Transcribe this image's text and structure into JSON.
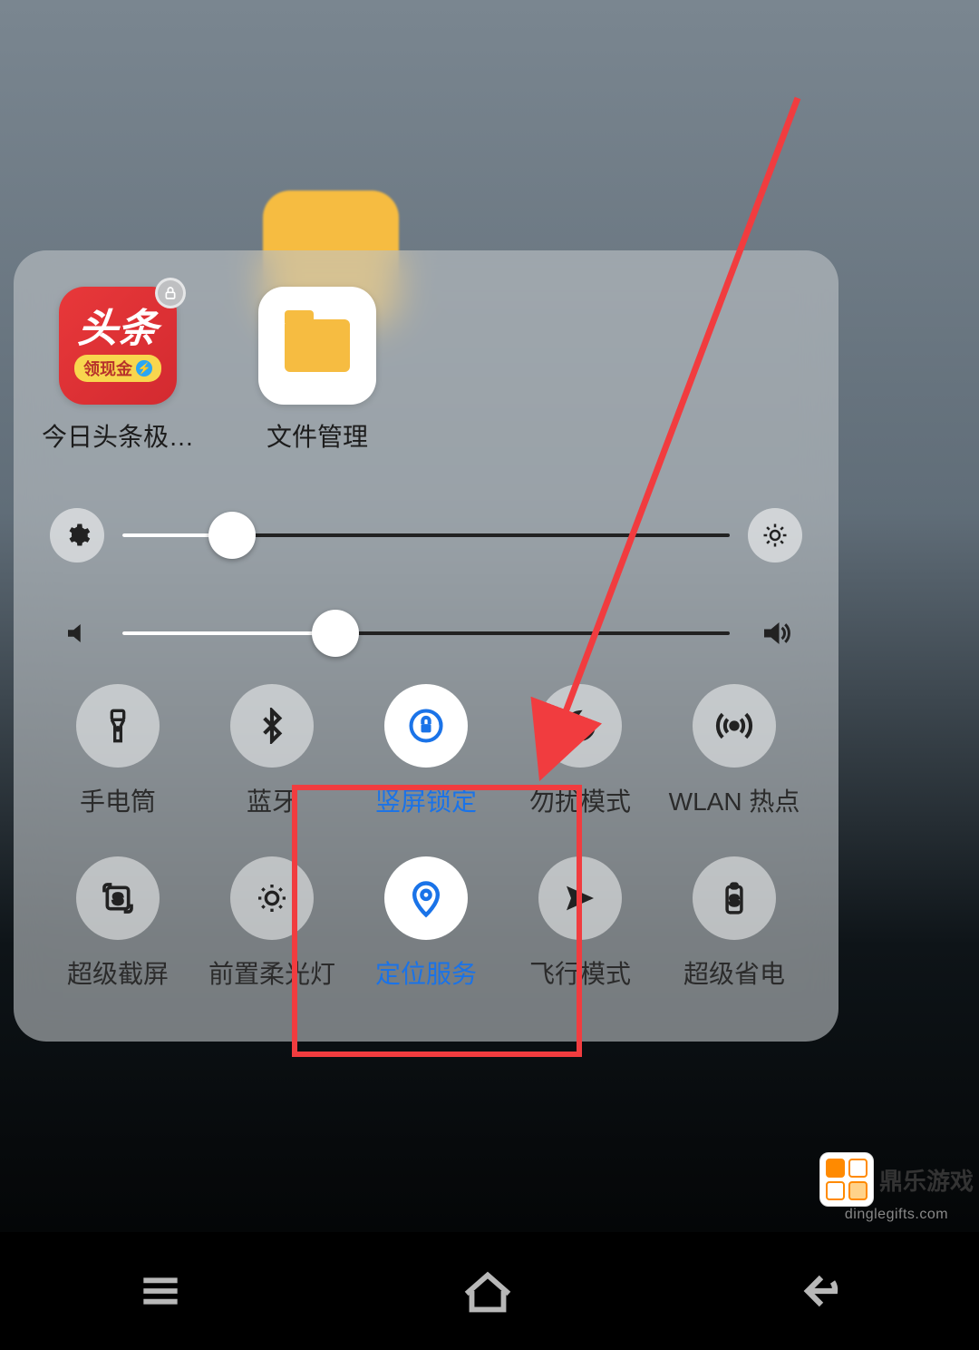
{
  "apps": [
    {
      "label": "今日头条极…",
      "icon_text": "头条",
      "icon_sub": "领现金",
      "locked": true
    },
    {
      "label": "文件管理"
    }
  ],
  "sliders": {
    "brightness": {
      "percent": 18
    },
    "volume": {
      "percent": 35
    }
  },
  "toggles_row1": [
    {
      "label": "手电筒",
      "active": false
    },
    {
      "label": "蓝牙",
      "active": false
    },
    {
      "label": "竖屏锁定",
      "active": true
    },
    {
      "label": "勿扰模式",
      "active": false
    },
    {
      "label": "WLAN 热点",
      "active": false
    }
  ],
  "toggles_row2": [
    {
      "label": "超级截屏",
      "active": false
    },
    {
      "label": "前置柔光灯",
      "active": false
    },
    {
      "label": "定位服务",
      "active": true
    },
    {
      "label": "飞行模式",
      "active": false
    },
    {
      "label": "超级省电",
      "active": false
    }
  ],
  "annotation": {
    "highlight_target": "定位服务",
    "arrow_target": "勿扰模式"
  },
  "watermark": {
    "title": "鼎乐游戏",
    "url": "dinglegifts.com"
  },
  "colors": {
    "accent": "#1A73E8",
    "annotation": "#F13C3F"
  }
}
